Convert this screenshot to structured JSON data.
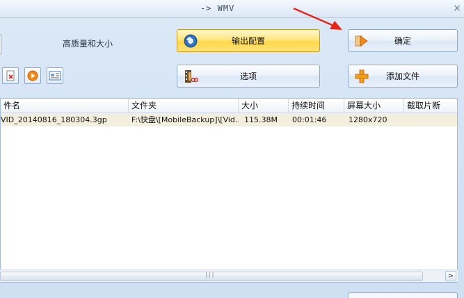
{
  "window": {
    "title": "-> WMV",
    "close_glyph": "×"
  },
  "options": {
    "quality_label": "高质量和大小"
  },
  "buttons": {
    "output_config": "输出配置",
    "confirm": "确定",
    "options": "选项",
    "add_file": "添加文件"
  },
  "toolbar_icons": [
    "delete-file-icon",
    "play-icon",
    "properties-icon"
  ],
  "table": {
    "columns": [
      "件名",
      "文件夹",
      "大小",
      "持续时间",
      "屏幕大小",
      "截取片断"
    ],
    "rows": [
      [
        "VID_20140816_180304.3gp",
        "F:\\快盘\\[MobileBackup]\\[Vid...",
        "115.38M",
        "00:01:46",
        "1280x720",
        ""
      ]
    ]
  },
  "scrollbar": {
    "grip": "|||",
    "right_arrow": ">"
  },
  "colors": {
    "accent_gold": "#ffd84a",
    "row_highlight": "#f3efdf",
    "annotation_arrow": "#e8241b"
  }
}
